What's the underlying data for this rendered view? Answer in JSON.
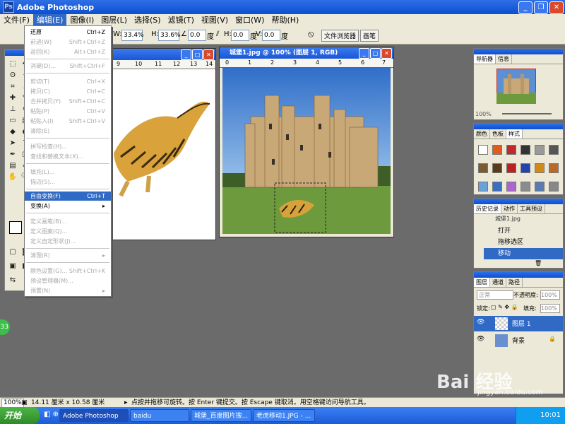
{
  "app": {
    "title": "Adobe Photoshop"
  },
  "menubar": [
    "文件(F)",
    "编辑(E)",
    "图像(I)",
    "图层(L)",
    "选择(S)",
    "滤镜(T)",
    "视图(V)",
    "窗口(W)",
    "帮助(H)"
  ],
  "options": {
    "w_label": "W:",
    "w_value": "33.4%",
    "h_label": "H:",
    "h_value": "33.6%",
    "angle_value": "0.0",
    "angle_unit": "度",
    "hskew_label": "H:",
    "hskew_value": "0.0",
    "hskew_unit": "度",
    "vskew_label": "V:",
    "vskew_value": "0.0",
    "vskew_unit": "度",
    "cancel_symbol": "⦸",
    "commit_symbol": "✓",
    "well_tabs": [
      "文件浏览器",
      "画笔"
    ]
  },
  "edit_menu": {
    "items": [
      {
        "label": "还原",
        "shortcut": "Ctrl+Z",
        "enabled": true
      },
      {
        "label": "前进(W)",
        "shortcut": "Shift+Ctrl+Z",
        "enabled": false
      },
      {
        "label": "返回(K)",
        "shortcut": "Alt+Ctrl+Z",
        "enabled": false
      },
      {
        "label": "消褪(D)...",
        "shortcut": "Shift+Ctrl+F",
        "enabled": false
      },
      {
        "label": "剪切(T)",
        "shortcut": "Ctrl+X",
        "enabled": false
      },
      {
        "label": "拷贝(C)",
        "shortcut": "Ctrl+C",
        "enabled": false
      },
      {
        "label": "合并拷贝(Y)",
        "shortcut": "Shift+Ctrl+C",
        "enabled": false
      },
      {
        "label": "粘贴(P)",
        "shortcut": "Ctrl+V",
        "enabled": false
      },
      {
        "label": "粘贴入(I)",
        "shortcut": "Shift+Ctrl+V",
        "enabled": false
      },
      {
        "label": "清除(E)",
        "shortcut": "",
        "enabled": false
      },
      {
        "label": "拼写检查(H)...",
        "shortcut": "",
        "enabled": false
      },
      {
        "label": "查找和替换文本(X)...",
        "shortcut": "",
        "enabled": false
      },
      {
        "label": "填充(L)...",
        "shortcut": "",
        "enabled": false
      },
      {
        "label": "描边(S)...",
        "shortcut": "",
        "enabled": false
      },
      {
        "label": "自由变换(F)",
        "shortcut": "Ctrl+T",
        "enabled": true,
        "highlighted": true
      },
      {
        "label": "变换(A)",
        "shortcut": "▸",
        "enabled": true
      },
      {
        "label": "定义画笔(B)...",
        "shortcut": "",
        "enabled": false
      },
      {
        "label": "定义图案(Q)...",
        "shortcut": "",
        "enabled": false
      },
      {
        "label": "定义自定形状(J)...",
        "shortcut": "",
        "enabled": false
      },
      {
        "label": "清理(R)",
        "shortcut": "▸",
        "enabled": false
      },
      {
        "label": "颜色设置(G)...",
        "shortcut": "Shift+Ctrl+K",
        "enabled": false
      },
      {
        "label": "预设管理器(M)...",
        "shortcut": "",
        "enabled": false
      },
      {
        "label": "预置(N)",
        "shortcut": "▸",
        "enabled": false
      }
    ]
  },
  "doc2": {
    "title": "城堡1.jpg @ 100% (图层 1, RGB)"
  },
  "ruler1": [
    "9",
    "10",
    "11",
    "12",
    "13",
    "14"
  ],
  "ruler2": [
    "0",
    "1",
    "2",
    "3",
    "4",
    "5",
    "6",
    "7"
  ],
  "navigator": {
    "tabs": [
      "导航器",
      "信息"
    ],
    "zoom": "100%"
  },
  "swatches": {
    "tabs": [
      "颜色",
      "色板",
      "样式"
    ]
  },
  "history": {
    "tabs": [
      "历史记录",
      "动作",
      "工具预设"
    ],
    "items": [
      "城堡1.jpg",
      "打开",
      "拖移选区",
      "移动"
    ]
  },
  "layers": {
    "tabs": [
      "图层",
      "通道",
      "路径"
    ],
    "blend_mode": "正常",
    "opacity_label": "不透明度:",
    "opacity_value": "100%",
    "lock_label": "锁定:",
    "fill_label": "填充:",
    "fill_value": "100%",
    "items": [
      "图层 1",
      "背景"
    ]
  },
  "status": {
    "zoom": "100%",
    "doc_size": "14.11 厘米 x 10.58 厘米",
    "hint": "点按并拖移可旋转。按 Enter 键提交。按 Escape 键取消。用空格键访问导航工具。"
  },
  "taskbar": {
    "start": "开始",
    "tasks": [
      "Adobe Photoshop",
      "baidu",
      "城堡_百度图片搜...",
      "老虎移动1.JPG - ..."
    ],
    "clock": "10:01"
  },
  "watermark": {
    "brand": "Bai 经验",
    "url": "jingyan.baidu.com"
  },
  "side_badge": "33",
  "colors": {
    "title_blue": "#0b4fd0",
    "menu_bg": "#ece9d8",
    "highlight": "#316ac5",
    "taskbar": "#1d5bd8",
    "start_green": "#2f8a27"
  }
}
